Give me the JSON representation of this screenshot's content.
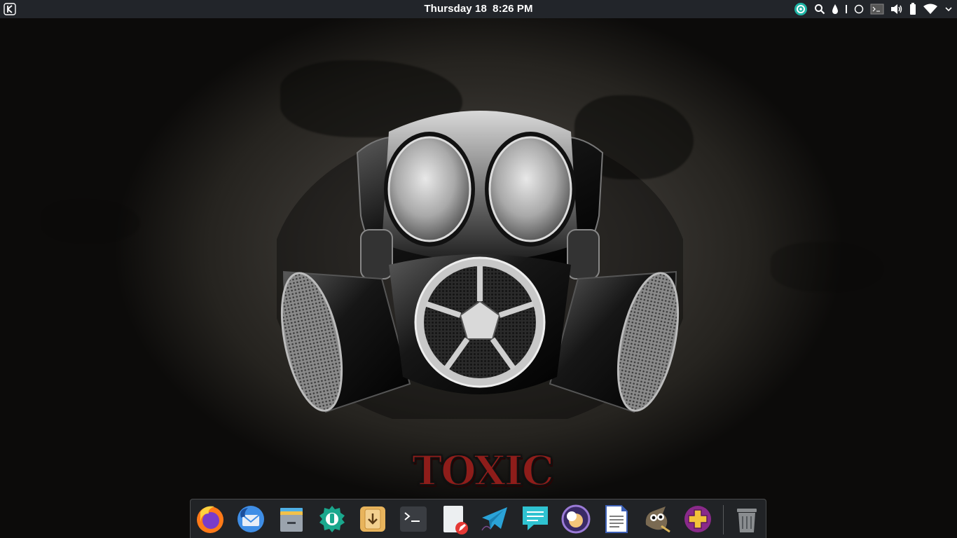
{
  "top_panel": {
    "clock": {
      "day": "Thursday 18",
      "time": "8:26 PM"
    },
    "tray_icons": [
      "plasma-update-icon",
      "search-icon",
      "droplet-icon",
      "bar-icon",
      "circle-icon",
      "terminal-icon",
      "volume-icon",
      "battery-icon",
      "wifi-icon"
    ]
  },
  "wallpaper": {
    "logo_text": "TOXIC",
    "accent": "#8e1d1a"
  },
  "dock": {
    "items": [
      {
        "name": "firefox",
        "icon": "firefox-icon"
      },
      {
        "name": "thunderbird",
        "icon": "thunderbird-icon"
      },
      {
        "name": "files",
        "icon": "file-manager-icon"
      },
      {
        "name": "system-settings",
        "icon": "settings-icon"
      },
      {
        "name": "downloader",
        "icon": "download-icon"
      },
      {
        "name": "terminal",
        "icon": "terminal-icon"
      },
      {
        "name": "text-editor",
        "icon": "text-editor-icon"
      },
      {
        "name": "telegram",
        "icon": "telegram-icon"
      },
      {
        "name": "chat",
        "icon": "chat-icon"
      },
      {
        "name": "music",
        "icon": "music-player-icon"
      },
      {
        "name": "writer",
        "icon": "document-icon"
      },
      {
        "name": "gimp",
        "icon": "gimp-icon"
      },
      {
        "name": "software-center",
        "icon": "plus-icon"
      },
      {
        "name": "trash",
        "icon": "trash-icon"
      }
    ]
  }
}
